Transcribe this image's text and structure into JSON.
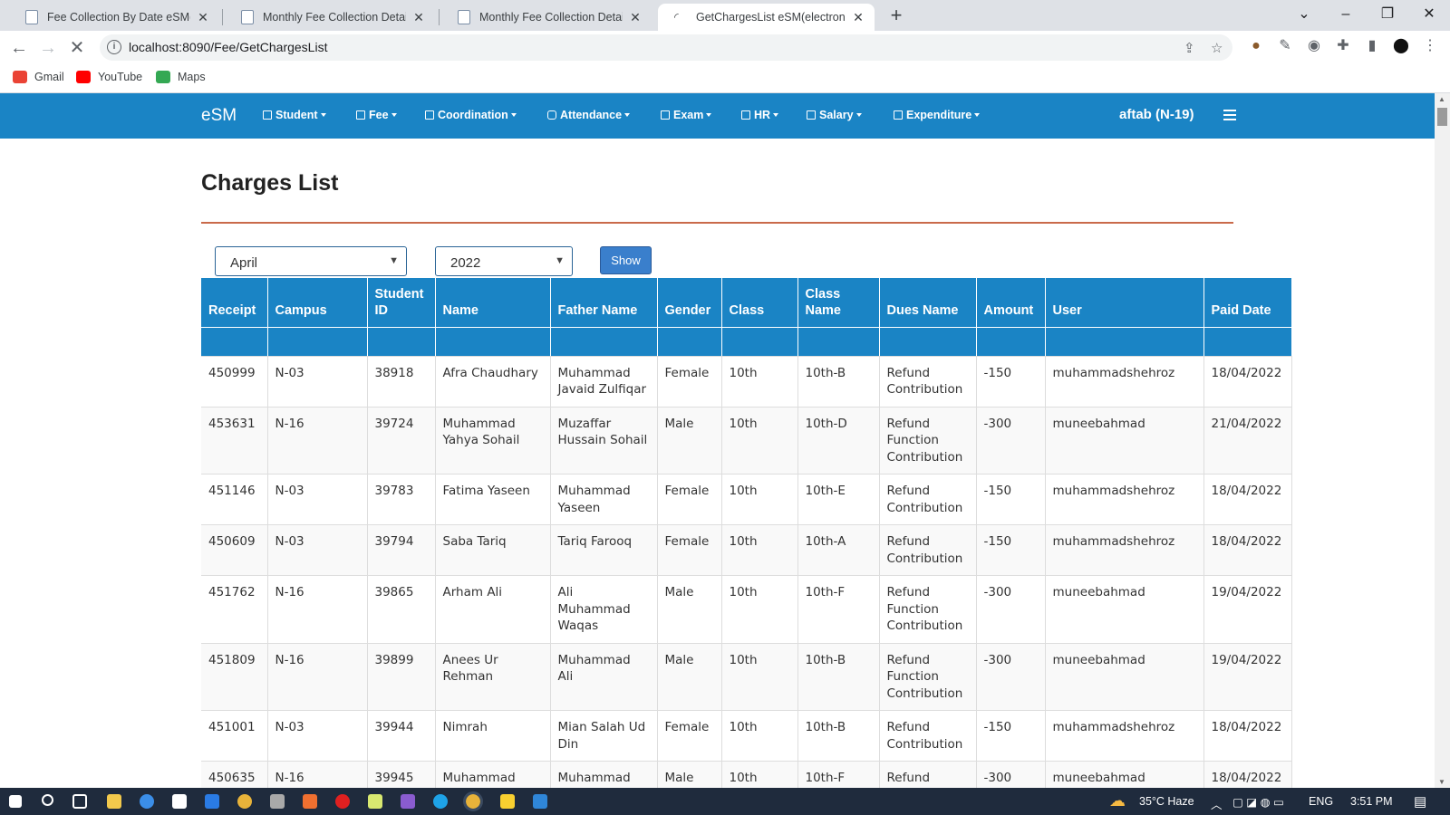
{
  "browser": {
    "tabs": [
      {
        "title": "Fee Collection By Date eSM(elect",
        "active": false
      },
      {
        "title": "Monthly Fee Collection Detail eSM",
        "active": false
      },
      {
        "title": "Monthly Fee Collection Detail eSM",
        "active": false
      },
      {
        "title": "GetChargesList eSM(electronic Sc",
        "active": true
      }
    ],
    "url": "localhost:8090/Fee/GetChargesList",
    "bookmarks": [
      {
        "label": "Gmail",
        "color": "#ea4335"
      },
      {
        "label": "YouTube",
        "color": "#ff0000"
      },
      {
        "label": "Maps",
        "color": "#34a853"
      }
    ]
  },
  "app": {
    "brand": "eSM",
    "menu": [
      "Student",
      "Fee",
      "Coordination",
      "Attendance",
      "Exam",
      "HR",
      "Salary",
      "Expenditure"
    ],
    "user": "aftab (N-19)",
    "accent": "#1a84c5"
  },
  "page": {
    "title": "Charges List",
    "month": "April",
    "year": "2022",
    "show_label": "Show"
  },
  "table": {
    "columns": [
      "Receipt",
      "Campus",
      "Student ID",
      "Name",
      "Father Name",
      "Gender",
      "Class",
      "Class Name",
      "Dues Name",
      "Amount",
      "User",
      "Paid Date"
    ],
    "rows": [
      [
        "450999",
        "N-03",
        "38918",
        "Afra Chaudhary",
        "Muhammad Javaid Zulfiqar",
        "Female",
        "10th",
        "10th-B",
        "Refund Contribution",
        "-150",
        "muhammadshehroz",
        "18/04/2022"
      ],
      [
        "453631",
        "N-16",
        "39724",
        "Muhammad Yahya Sohail",
        "Muzaffar Hussain Sohail",
        "Male",
        "10th",
        "10th-D",
        "Refund Function Contribution",
        "-300",
        "muneebahmad",
        "21/04/2022"
      ],
      [
        "451146",
        "N-03",
        "39783",
        "Fatima Yaseen",
        "Muhammad Yaseen",
        "Female",
        "10th",
        "10th-E",
        "Refund Contribution",
        "-150",
        "muhammadshehroz",
        "18/04/2022"
      ],
      [
        "450609",
        "N-03",
        "39794",
        "Saba Tariq",
        "Tariq Farooq",
        "Female",
        "10th",
        "10th-A",
        "Refund Contribution",
        "-150",
        "muhammadshehroz",
        "18/04/2022"
      ],
      [
        "451762",
        "N-16",
        "39865",
        "Arham Ali",
        "Ali Muhammad Waqas",
        "Male",
        "10th",
        "10th-F",
        "Refund Function Contribution",
        "-300",
        "muneebahmad",
        "19/04/2022"
      ],
      [
        "451809",
        "N-16",
        "39899",
        "Anees Ur Rehman",
        "Muhammad Ali",
        "Male",
        "10th",
        "10th-B",
        "Refund Function Contribution",
        "-300",
        "muneebahmad",
        "19/04/2022"
      ],
      [
        "451001",
        "N-03",
        "39944",
        "Nimrah",
        "Mian Salah Ud Din",
        "Female",
        "10th",
        "10th-B",
        "Refund Contribution",
        "-150",
        "muhammadshehroz",
        "18/04/2022"
      ],
      [
        "450635",
        "N-16",
        "39945",
        "Muhammad",
        "Muhammad",
        "Male",
        "10th",
        "10th-F",
        "Refund",
        "-300",
        "muneebahmad",
        "18/04/2022"
      ]
    ]
  },
  "taskbar": {
    "weather": "35°C  Haze",
    "lang": "ENG",
    "time": "3:51 PM"
  }
}
